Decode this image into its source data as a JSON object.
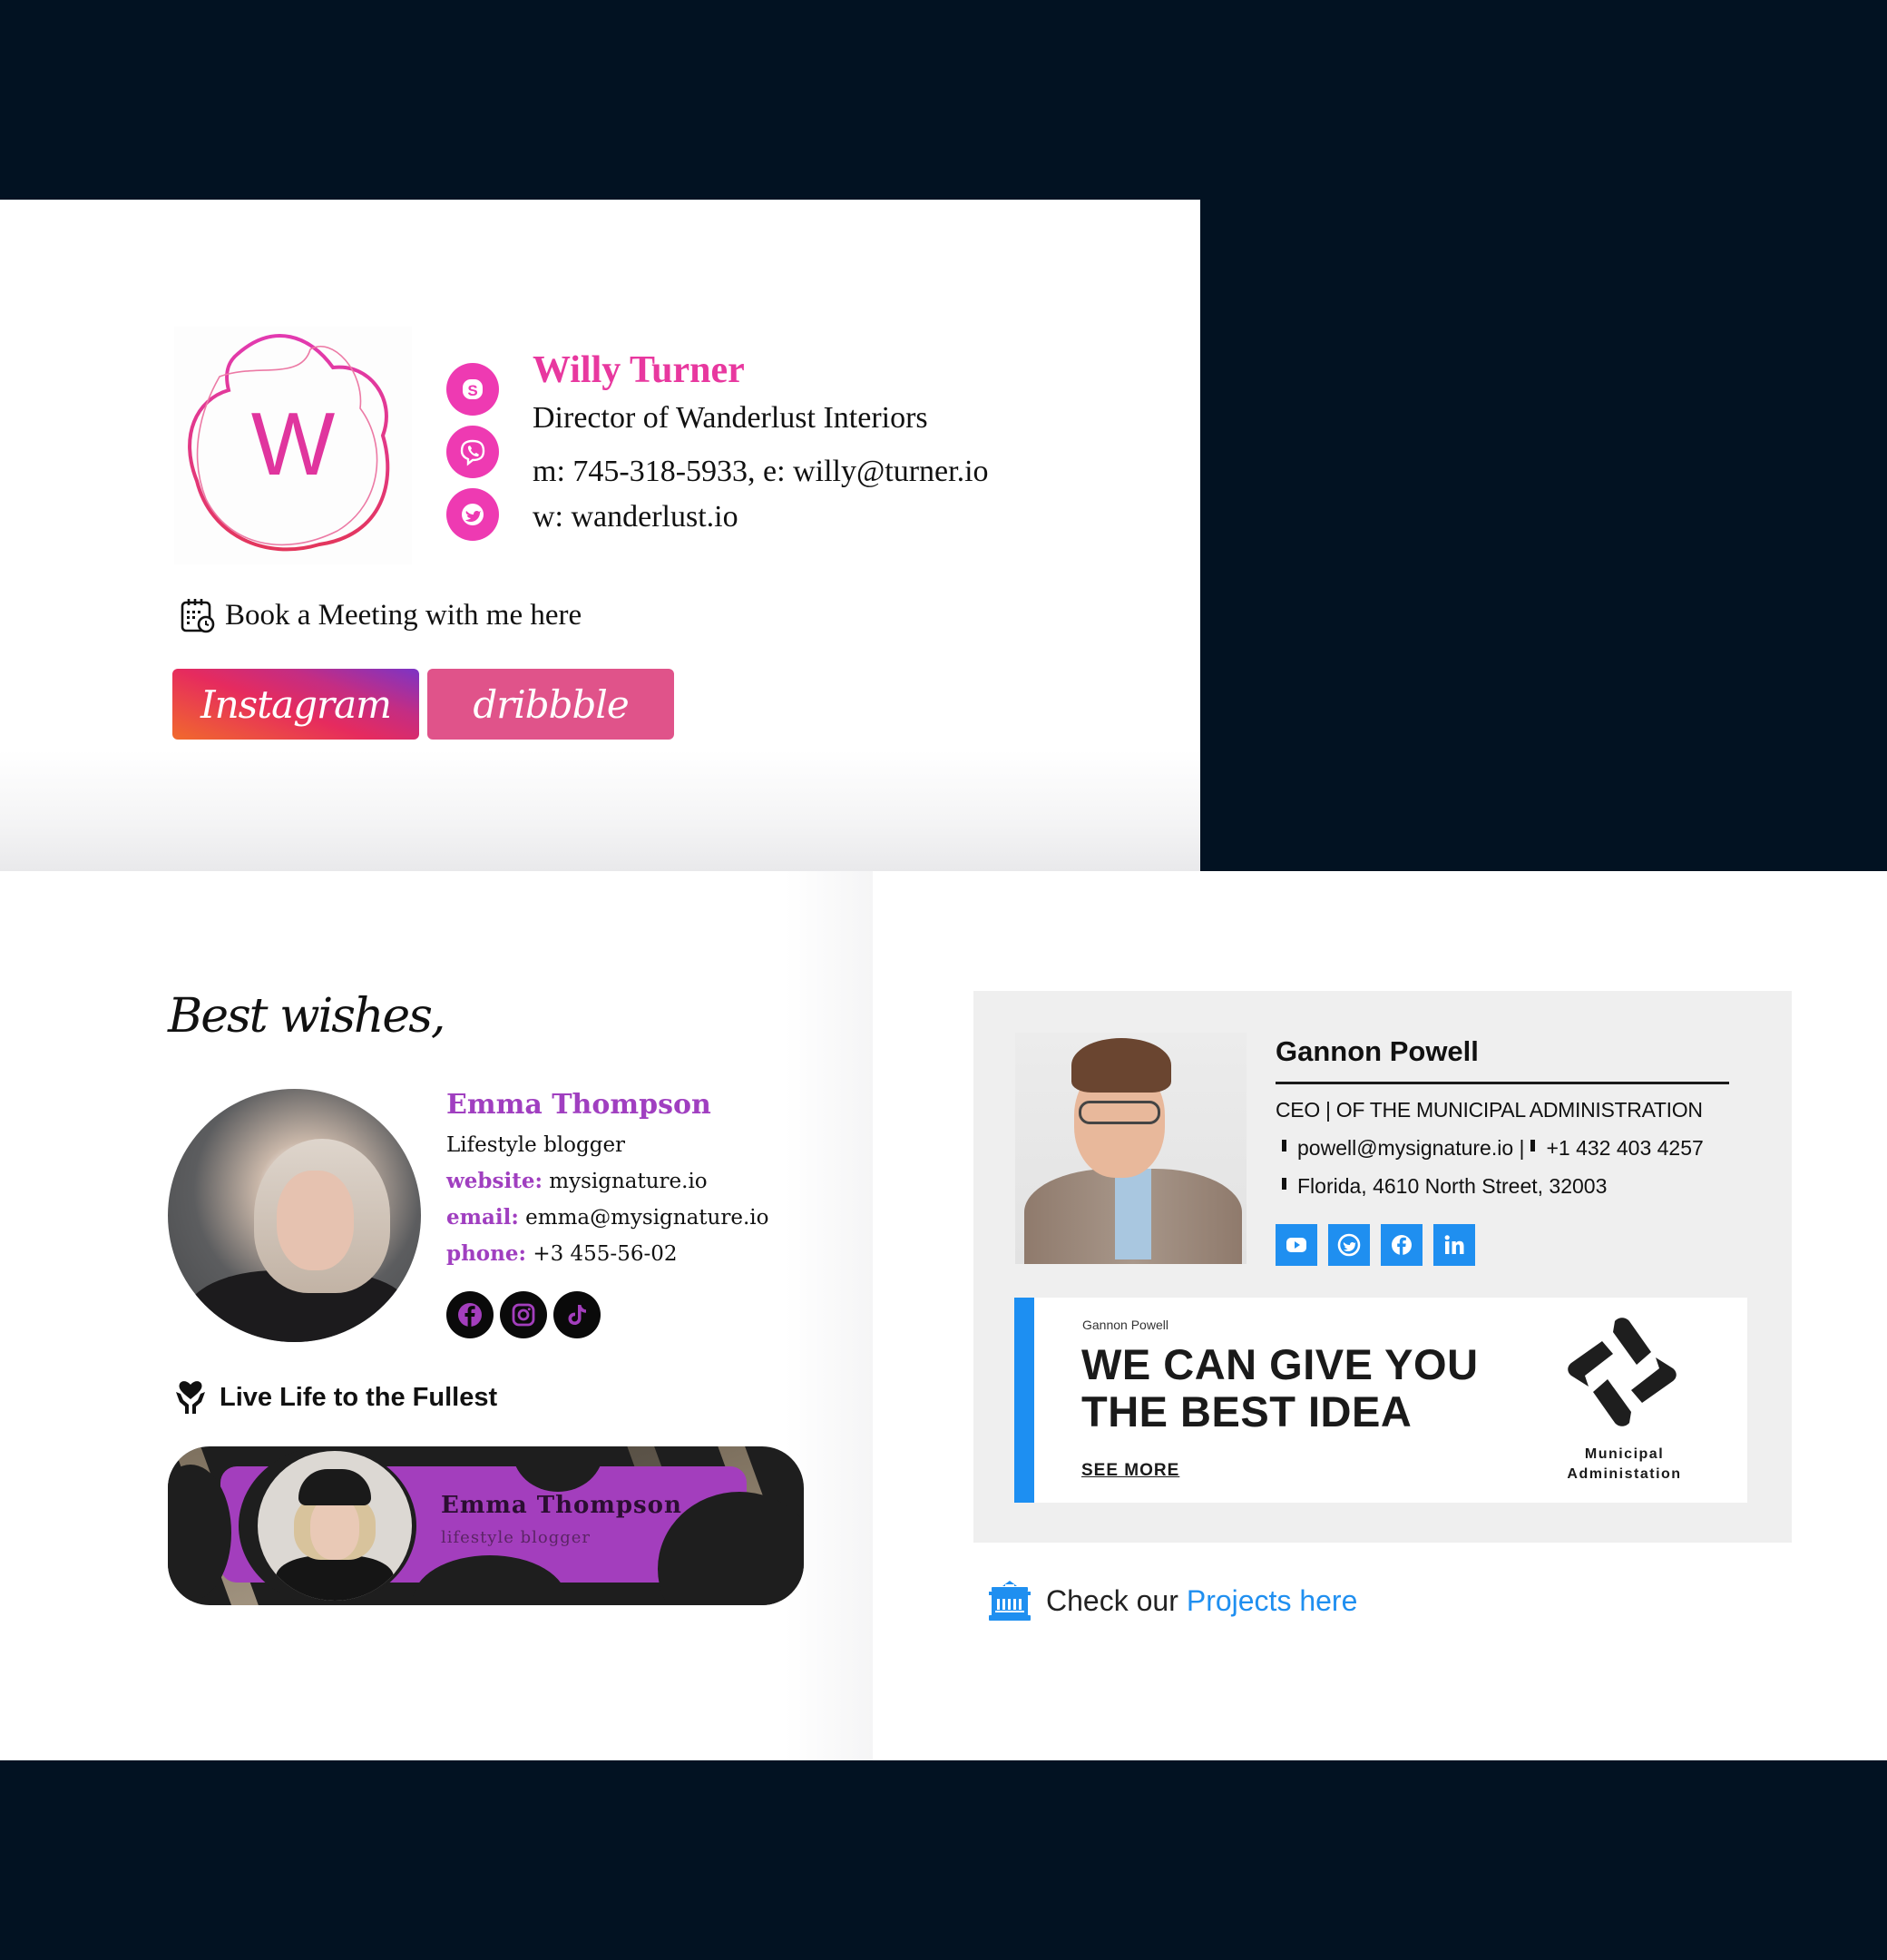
{
  "colors": {
    "background": "#021222",
    "willy_accent": "#e8389f",
    "emma_accent": "#a03fc0",
    "gannon_accent": "#1f8ff0"
  },
  "willy": {
    "logo_letter": "W",
    "name": "Willy Turner",
    "title": "Director of Wanderlust Interiors",
    "contact": "m: 745-318-5933, e: willy@turner.io",
    "website": "w: wanderlust.io",
    "socials": [
      "skype-icon",
      "viber-icon",
      "twitter-icon"
    ],
    "meeting_link": "Book a Meeting with me here",
    "meeting_icon": "calendar-clock-icon",
    "buttons": [
      {
        "label": "Instagram"
      },
      {
        "label": "dribbble"
      }
    ]
  },
  "emma": {
    "greeting": "Best wishes,",
    "name": "Emma Thompson",
    "title": "Lifestyle blogger",
    "website_label": "website:",
    "website": "mysignature.io",
    "email_label": "email:",
    "email": "emma@mysignature.io",
    "phone_label": "phone:",
    "phone": "+3 455-56-02",
    "socials": [
      "facebook-icon",
      "instagram-icon",
      "tiktok-icon"
    ],
    "motto_icon": "heart-hands-icon",
    "motto": "Live Life to the Fullest",
    "banner": {
      "name": "Emma Thompson",
      "title": "lifestyle blogger"
    }
  },
  "gannon": {
    "name": "Gannon Powell",
    "title": "CEO | OF THE MUNICIPAL ADMINISTRATION",
    "email": "powell@mysignature.io |",
    "phone": "+1 432 403 4257",
    "address": "Florida, 4610 North Street, 32003",
    "socials": [
      "youtube-icon",
      "twitter-icon",
      "facebook-icon",
      "linkedin-icon"
    ],
    "banner": {
      "small_name": "Gannon Powell",
      "headline_line1": "WE CAN GIVE YOU",
      "headline_line2": "THE BEST IDEA",
      "cta": "SEE MORE",
      "org_line1": "Municipal",
      "org_line2": "Administation"
    },
    "cta_icon": "building-icon",
    "cta_text": "Check our",
    "cta_link": "Projects here"
  }
}
